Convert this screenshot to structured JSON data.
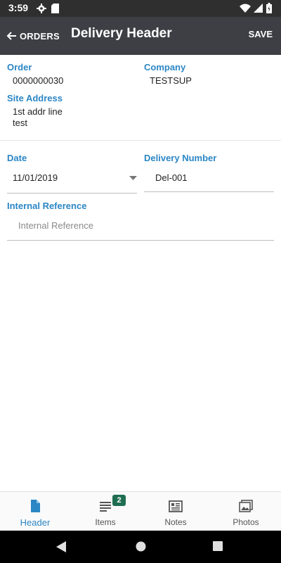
{
  "status_bar": {
    "time": "3:59"
  },
  "app_bar": {
    "back_label": "ORDERS",
    "title": "Delivery Header",
    "save_label": "SAVE"
  },
  "order": {
    "label": "Order",
    "value": "0000000030"
  },
  "company": {
    "label": "Company",
    "value": "TESTSUP"
  },
  "site_address": {
    "label": "Site Address",
    "line1": "1st addr line",
    "line2": "test"
  },
  "date": {
    "label": "Date",
    "value": "11/01/2019"
  },
  "delivery_number": {
    "label": "Delivery Number",
    "value": "Del-001"
  },
  "internal_reference": {
    "label": "Internal Reference",
    "placeholder": "Internal Reference"
  },
  "bottom_nav": {
    "tabs": [
      {
        "label": "Header",
        "icon": "document-icon",
        "active": true
      },
      {
        "label": "Items",
        "icon": "list-icon",
        "badge": "2"
      },
      {
        "label": "Notes",
        "icon": "notes-icon"
      },
      {
        "label": "Photos",
        "icon": "photos-icon"
      }
    ]
  },
  "colors": {
    "accent": "#2b86c5",
    "app_bar": "#3d3f45",
    "badge": "#1f6e52",
    "status_bar": "#2f2f2f"
  }
}
